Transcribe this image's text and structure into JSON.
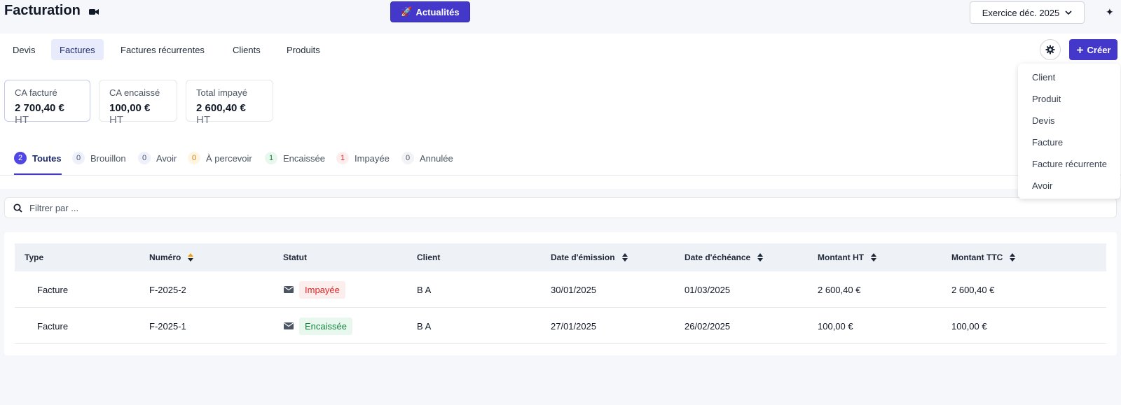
{
  "header": {
    "title": "Facturation",
    "news_label": "Actualités",
    "fiscal_year": "Exercice déc. 2025"
  },
  "nav": {
    "tabs": [
      "Devis",
      "Factures",
      "Factures récurrentes",
      "Clients",
      "Produits"
    ],
    "active_tab": "Factures",
    "create_label": "Créer"
  },
  "kpis": [
    {
      "label": "CA facturé",
      "value": "2 700,40 €",
      "unit": "HT"
    },
    {
      "label": "CA encaissé",
      "value": "100,00 €",
      "unit": "HT"
    },
    {
      "label": "Total impayé",
      "value": "2 600,40 €",
      "unit": "HT"
    }
  ],
  "status_tabs": [
    {
      "count": "2",
      "label": "Toutes"
    },
    {
      "count": "0",
      "label": "Brouillon"
    },
    {
      "count": "0",
      "label": "Avoir"
    },
    {
      "count": "0",
      "label": "À percevoir"
    },
    {
      "count": "1",
      "label": "Encaissée"
    },
    {
      "count": "1",
      "label": "Impayée"
    },
    {
      "count": "0",
      "label": "Annulée"
    }
  ],
  "filter": {
    "placeholder": "Filtrer par ..."
  },
  "table": {
    "columns": [
      "Type",
      "Numéro",
      "Statut",
      "Client",
      "Date d'émission",
      "Date d'échéance",
      "Montant HT",
      "Montant TTC"
    ],
    "rows": [
      [
        "Facture",
        "F-2025-2",
        "Impayée",
        "B A",
        "30/01/2025",
        "01/03/2025",
        "2 600,40 €",
        "2 600,40 €"
      ],
      [
        "Facture",
        "F-2025-1",
        "Encaissée",
        "B A",
        "27/01/2025",
        "26/02/2025",
        "100,00 €",
        "100,00 €"
      ]
    ]
  },
  "create_menu": [
    "Client",
    "Produit",
    "Devis",
    "Facture",
    "Facture récurrente",
    "Avoir"
  ],
  "colors": {
    "accent": "#4338ca",
    "unpaid_text": "#dc2626",
    "unpaid_bg": "#fdeeee",
    "paid_text": "#15803d",
    "paid_bg": "#e9f8ee"
  }
}
